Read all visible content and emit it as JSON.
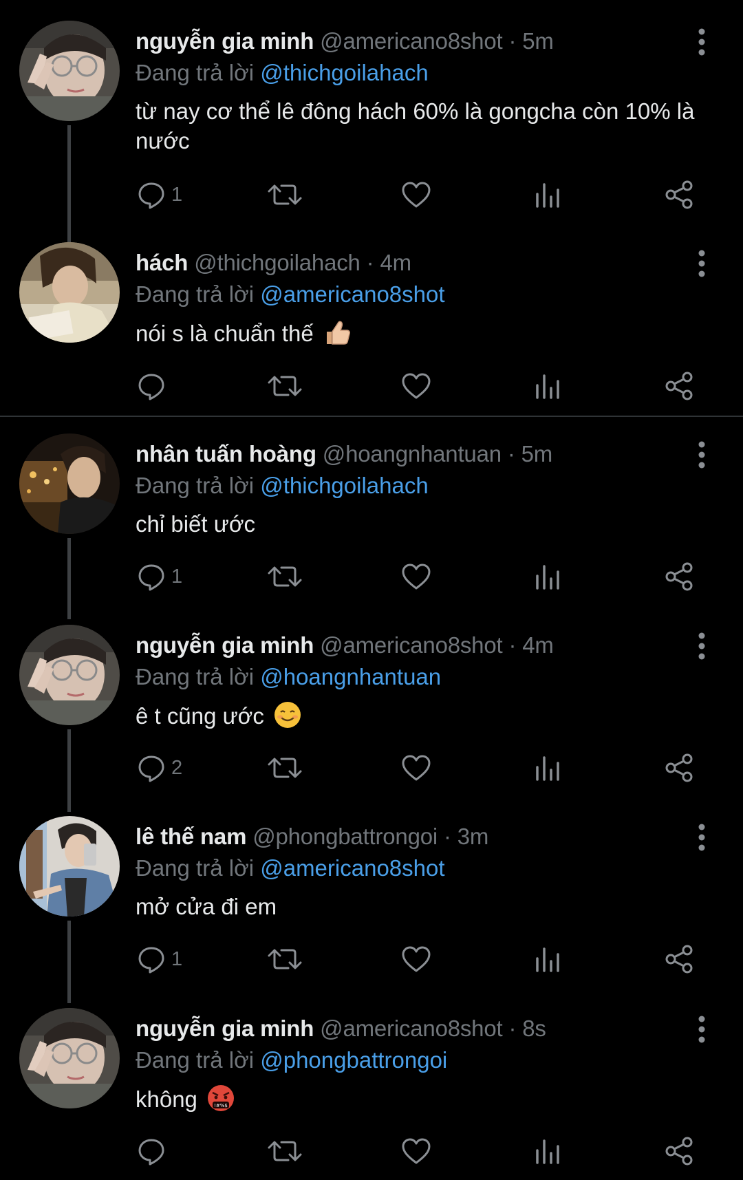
{
  "thread": {
    "reply_prefix": "Đang trả lời",
    "tweets": [
      {
        "name": "nguyễn gia minh",
        "handle": "@americano8shot",
        "separator": "·",
        "time": "5m",
        "reply_to": "@thichgoilahach",
        "text": "từ nay cơ thể lê đông hách 60% là gongcha còn 10% là nước",
        "emoji": "",
        "reply_count": "1",
        "avatar": "avatar-glasses-peace-sign"
      },
      {
        "name": "hách",
        "handle": "@thichgoilahach",
        "separator": "·",
        "time": "4m",
        "reply_to": "@americano8shot",
        "text": "nói s là chuẩn thế",
        "emoji": "thumbs-up-emoji",
        "reply_count": "",
        "avatar": "avatar-reading-book"
      },
      {
        "name": "nhân tuấn hoàng",
        "handle": "@hoangnhantuan",
        "separator": "·",
        "time": "5m",
        "reply_to": "@thichgoilahach",
        "text": "chỉ biết ước",
        "emoji": "",
        "reply_count": "1",
        "avatar": "avatar-night-city"
      },
      {
        "name": "nguyễn gia minh",
        "handle": "@americano8shot",
        "separator": "·",
        "time": "4m",
        "reply_to": "@hoangnhantuan",
        "text": "ê t cũng ước",
        "emoji": "smiling-face-emoji",
        "reply_count": "2",
        "avatar": "avatar-glasses-peace-sign"
      },
      {
        "name": "lê thế nam",
        "handle": "@phongbattrongoi",
        "separator": "·",
        "time": "3m",
        "reply_to": "@americano8shot",
        "text": "mở cửa đi em",
        "emoji": "",
        "reply_count": "1",
        "avatar": "avatar-mirror-selfie"
      },
      {
        "name": "nguyễn gia minh",
        "handle": "@americano8shot",
        "separator": "·",
        "time": "8s",
        "reply_to": "@phongbattrongoi",
        "text": "không",
        "emoji": "face-with-symbols-on-mouth-emoji",
        "reply_count": "",
        "avatar": "avatar-glasses-peace-sign"
      }
    ]
  },
  "colors": {
    "background": "#000000",
    "primary_text": "#e7e9ea",
    "secondary_text": "#71767b",
    "link": "#4a9fe8",
    "thread_line": "#3e4144",
    "divider": "#2f3336"
  }
}
